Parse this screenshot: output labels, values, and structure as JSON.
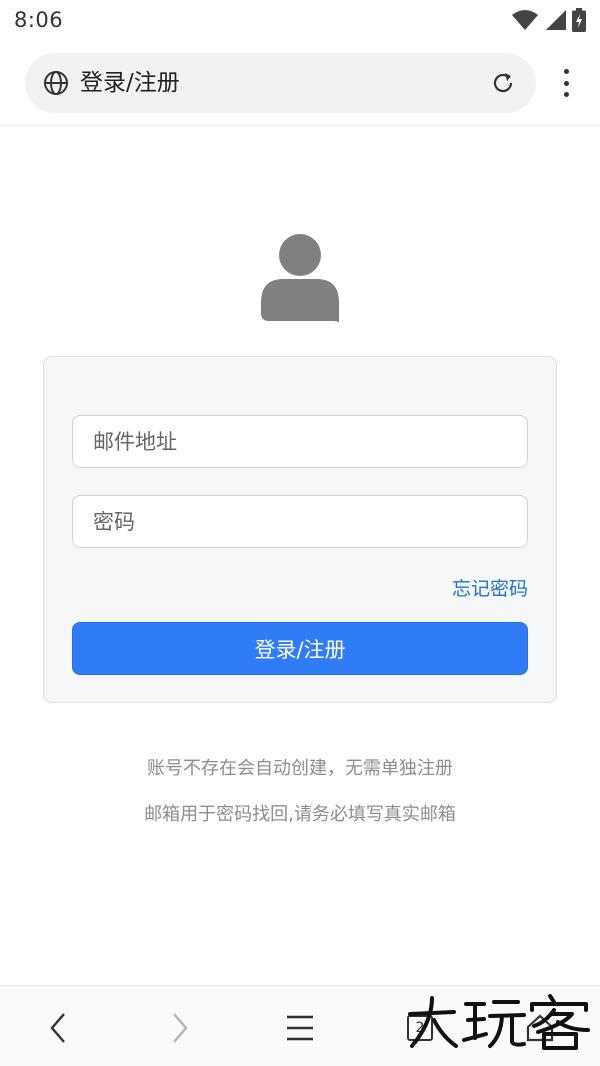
{
  "status_bar": {
    "time": "8:06"
  },
  "browser": {
    "title": "登录/注册"
  },
  "form": {
    "email_placeholder": "邮件地址",
    "password_placeholder": "密码",
    "forgot_label": "忘记密码",
    "submit_label": "登录/注册"
  },
  "notices": [
    "账号不存在会自动创建，无需单独注册",
    "邮箱用于密码找回,请务必填写真实邮箱"
  ],
  "bottom_nav": {
    "tab_count": "2"
  },
  "watermark": {
    "text": "大玩客"
  },
  "colors": {
    "accent": "#2f7cf6",
    "link": "#1f6fd1",
    "notice_text": "#8d8d8d",
    "avatar": "#808080"
  },
  "icons": [
    "globe-icon",
    "reload-icon",
    "more-vert-icon",
    "user-avatar-icon",
    "wifi-icon",
    "signal-icon",
    "battery-icon",
    "back-icon",
    "forward-icon",
    "hamburger-icon",
    "tabs-icon",
    "home-icon"
  ]
}
